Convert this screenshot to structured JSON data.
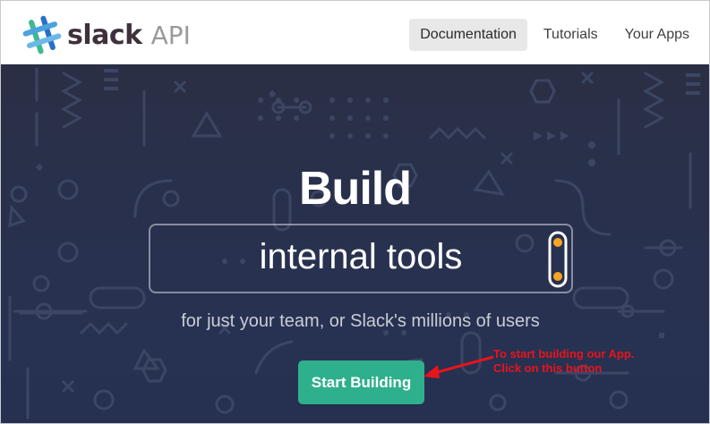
{
  "header": {
    "logo_word": "slack",
    "logo_suffix": "API",
    "nav": [
      {
        "label": "Documentation",
        "active": true
      },
      {
        "label": "Tutorials",
        "active": false
      },
      {
        "label": "Your Apps",
        "active": false
      }
    ]
  },
  "hero": {
    "title": "Build",
    "tagline": "internal tools",
    "subtitle": "for just your team, or Slack's millions of users",
    "cta_label": "Start Building"
  },
  "annotation": {
    "line1": "To start building our App.",
    "line2": "Click on this button"
  },
  "colors": {
    "hero_bg": "#283150",
    "cta_bg": "#2fb08d",
    "annotation": "#e8141c",
    "slider_dot": "#f5a623"
  }
}
